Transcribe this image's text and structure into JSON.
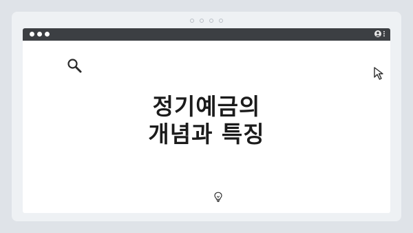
{
  "headline": {
    "line1": "정기예금의",
    "line2": "개념과 특징"
  },
  "icons": {
    "search": "search-icon",
    "cursor": "cursor-arrow-icon",
    "bulb": "lightbulb-icon",
    "user": "user-icon",
    "menu": "kebab-menu-icon"
  },
  "colors": {
    "background": "#dfe3e8",
    "card": "#eef1f4",
    "titlebar": "#3c3f43",
    "text": "#1b1b1b"
  }
}
